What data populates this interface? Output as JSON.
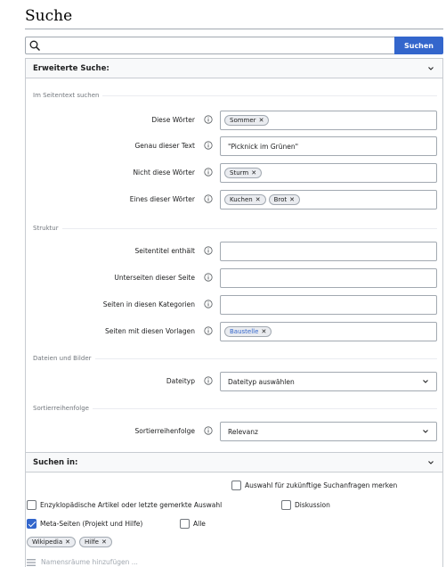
{
  "page": {
    "title": "Suche"
  },
  "search": {
    "query": "",
    "button": "Suchen"
  },
  "advanced": {
    "header": "Erweiterte Suche:",
    "text_section": {
      "legend": "Im Seitentext suchen",
      "fields": [
        {
          "label": "Diese Wörter",
          "chips": [
            "Sommer"
          ],
          "value": ""
        },
        {
          "label": "Genau dieser Text",
          "chips": [],
          "value": "\"Picknick im Grünen\""
        },
        {
          "label": "Nicht diese Wörter",
          "chips": [
            "Sturm"
          ],
          "value": ""
        },
        {
          "label": "Eines dieser Wörter",
          "chips": [
            "Kuchen",
            "Brot"
          ],
          "value": ""
        }
      ]
    },
    "structure_section": {
      "legend": "Struktur",
      "fields": [
        {
          "label": "Seitentitel enthält",
          "chips": [],
          "value": ""
        },
        {
          "label": "Unterseiten dieser Seite",
          "chips": [],
          "value": ""
        },
        {
          "label": "Seiten in diesen Kategorien",
          "chips": [],
          "value": ""
        },
        {
          "label": "Seiten mit diesen Vorlagen",
          "chips": [
            "Baustelle"
          ],
          "value": ""
        }
      ]
    },
    "files_section": {
      "legend": "Dateien und Bilder",
      "filetype_label": "Dateityp",
      "filetype_value": "Dateityp auswählen"
    },
    "sort_section": {
      "legend": "Sortierreihenfolge",
      "sort_label": "Sortierreihenfolge",
      "sort_value": "Relevanz"
    }
  },
  "namespaces": {
    "header": "Suchen in:",
    "remember_label": "Auswahl für zukünftige Suchanfragen merken",
    "remember_checked": false,
    "options": [
      {
        "label": "Enzyklopädische Artikel oder letzte gemerkte Auswahl",
        "checked": false
      },
      {
        "label": "Diskussion",
        "checked": false
      },
      {
        "label": "Meta-Seiten (Projekt und Hilfe)",
        "checked": true
      },
      {
        "label": "Alle",
        "checked": false
      }
    ],
    "selected_chips": [
      "Wikipedia",
      "Hilfe"
    ],
    "add_placeholder": "Namensräume hinzufügen ..."
  },
  "colors": {
    "accent": "#3366cc",
    "border": "#a2a9b1",
    "header_bg": "#f8f9fa"
  },
  "icons": {
    "search": "magnifier-icon",
    "info": "info-icon",
    "chevron": "chevron-down-icon",
    "remove": "x-icon",
    "list": "list-icon"
  }
}
